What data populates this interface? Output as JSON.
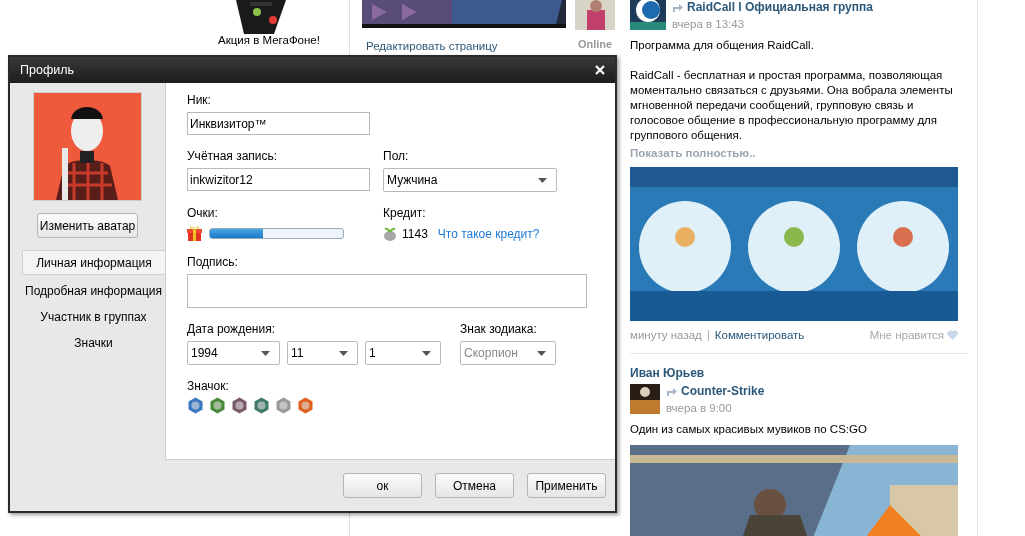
{
  "background": {
    "promo": {
      "caption": "Акция в МегаФоне!"
    },
    "profile": {
      "edit_link": "Редактировать страницу"
    },
    "friend": {
      "status": "Online"
    }
  },
  "feed": [
    {
      "source": "RaidCall l Официальная группа",
      "time": "вчера в 13:43",
      "text": [
        "Программа для общения RaidCall.",
        "RaidCall - бесплатная и простая программа, позволяющая моментально связаться с друзьями. Она вобрала элементы мгновенной передачи сообщений, групповую связь и голосовое общение в профессиональную программу для группового общения."
      ],
      "more": "Показать полностью..",
      "footer": {
        "time": "минуту назад",
        "comment": "Комментировать",
        "like": "Мне нравится"
      }
    },
    {
      "author": "Иван Юрьев",
      "source": "Counter-Strike",
      "time": "вчера в 9:00",
      "text": [
        "Один из самых красивых мувиков по CS:GO"
      ]
    }
  ],
  "dialog": {
    "title": "Профиль",
    "change_avatar": "Изменить аватар",
    "nav": [
      {
        "label": "Личная информация",
        "selected": true
      },
      {
        "label": "Подробная информация",
        "selected": false
      },
      {
        "label": "Участник в группах",
        "selected": false
      },
      {
        "label": "Значки",
        "selected": false
      }
    ],
    "nick": {
      "label": "Ник:",
      "value": "Инквизитор™"
    },
    "account": {
      "label": "Учётная запись:",
      "value": "inkwizitor12"
    },
    "gender": {
      "label": "Пол:",
      "value": "Мужчина"
    },
    "points": {
      "label": "Очки:",
      "level": 0.4
    },
    "credit": {
      "label": "Кредит:",
      "amount": "1143",
      "link": "Что такое кредит?"
    },
    "signature": {
      "label": "Подпись:"
    },
    "birth": {
      "label": "Дата рождения:",
      "year": "1994",
      "month": "11",
      "day": "1"
    },
    "zodiac": {
      "label": "Знак зодиака:",
      "value": "Скорпион",
      "disabled": true
    },
    "badges": {
      "label": "Значок:",
      "items": [
        {
          "color": "#3a78c0"
        },
        {
          "color": "#4a8a3a"
        },
        {
          "color": "#7a5a6a"
        },
        {
          "color": "#3f7a6a"
        },
        {
          "color": "#9a9a9a"
        },
        {
          "color": "#e06020"
        }
      ]
    },
    "buttons": [
      "ок",
      "Отмена",
      "Применить"
    ]
  }
}
